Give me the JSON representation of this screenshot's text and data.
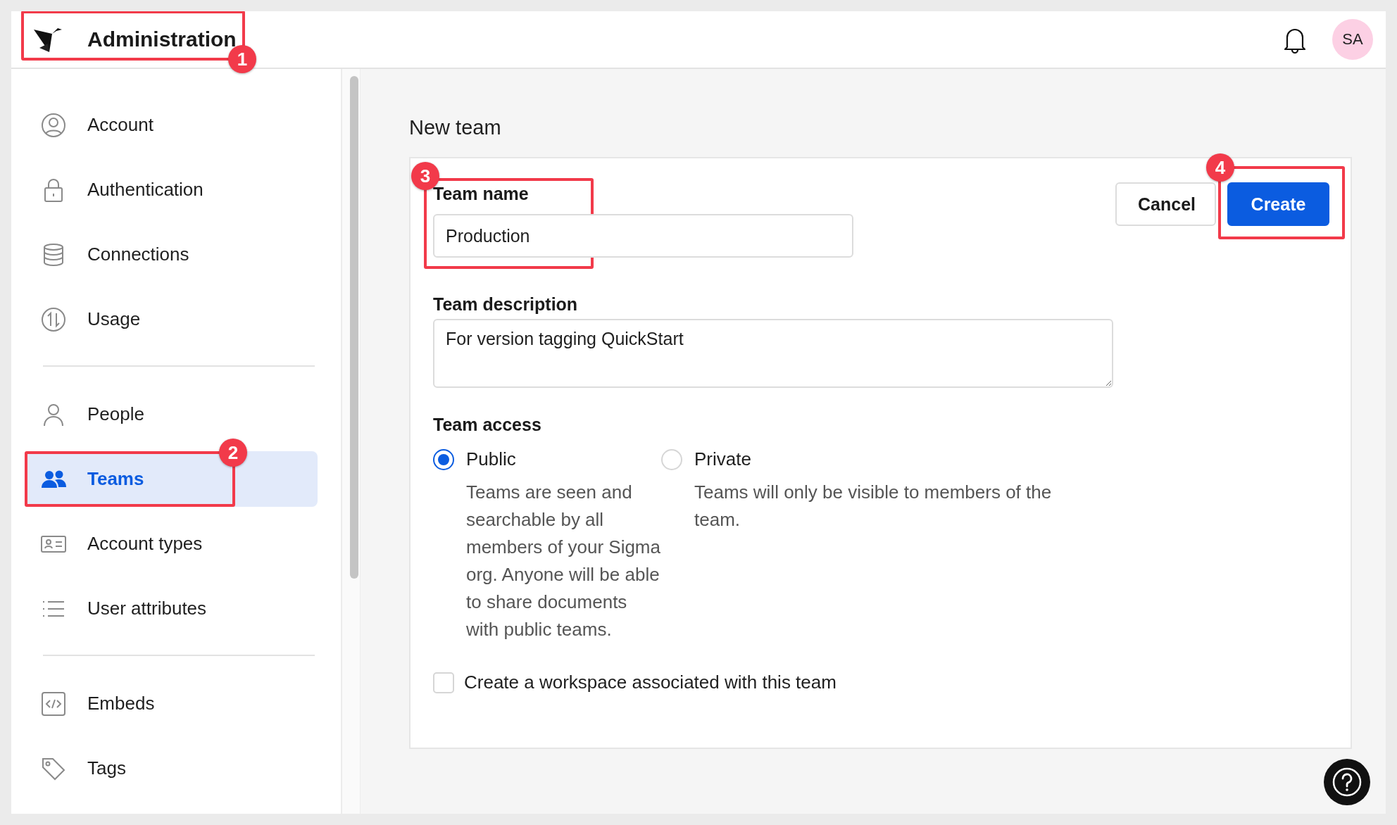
{
  "header": {
    "title": "Administration",
    "callout": "1",
    "avatar": "SA"
  },
  "sidebar": {
    "groups": [
      {
        "items": [
          {
            "label": "Account",
            "kind": "account",
            "selected": false
          },
          {
            "label": "Authentication",
            "kind": "lock",
            "selected": false
          },
          {
            "label": "Connections",
            "kind": "database",
            "selected": false
          },
          {
            "label": "Usage",
            "kind": "usage",
            "selected": false
          }
        ]
      },
      {
        "items": [
          {
            "label": "People",
            "kind": "person",
            "selected": false
          },
          {
            "label": "Teams",
            "kind": "team",
            "selected": true,
            "callout": "2"
          },
          {
            "label": "Account types",
            "kind": "idcard",
            "selected": false
          },
          {
            "label": "User attributes",
            "kind": "list",
            "selected": false
          }
        ]
      },
      {
        "items": [
          {
            "label": "Embeds",
            "kind": "code",
            "selected": false
          },
          {
            "label": "Tags",
            "kind": "tag",
            "selected": false
          }
        ]
      }
    ]
  },
  "page": {
    "title": "New team"
  },
  "form": {
    "name_field": {
      "label": "Team name",
      "value": "Production",
      "callout": "3"
    },
    "description_field": {
      "label": "Team description",
      "value": "For version tagging QuickStart"
    },
    "access": {
      "label": "Team access",
      "options": [
        {
          "label": "Public",
          "description": "Teams are seen and searchable by all members of your Sigma org. Anyone will be able to share documents with public teams.",
          "selected": true
        },
        {
          "label": "Private",
          "description": "Teams will only be visible to members of the team.",
          "selected": false
        }
      ]
    },
    "workspace_checkbox": {
      "label": "Create a workspace associated with this team",
      "checked": false
    },
    "buttons": [
      {
        "label": "Cancel",
        "kind": "secondary"
      },
      {
        "label": "Create",
        "kind": "primary",
        "callout": "4"
      }
    ]
  }
}
